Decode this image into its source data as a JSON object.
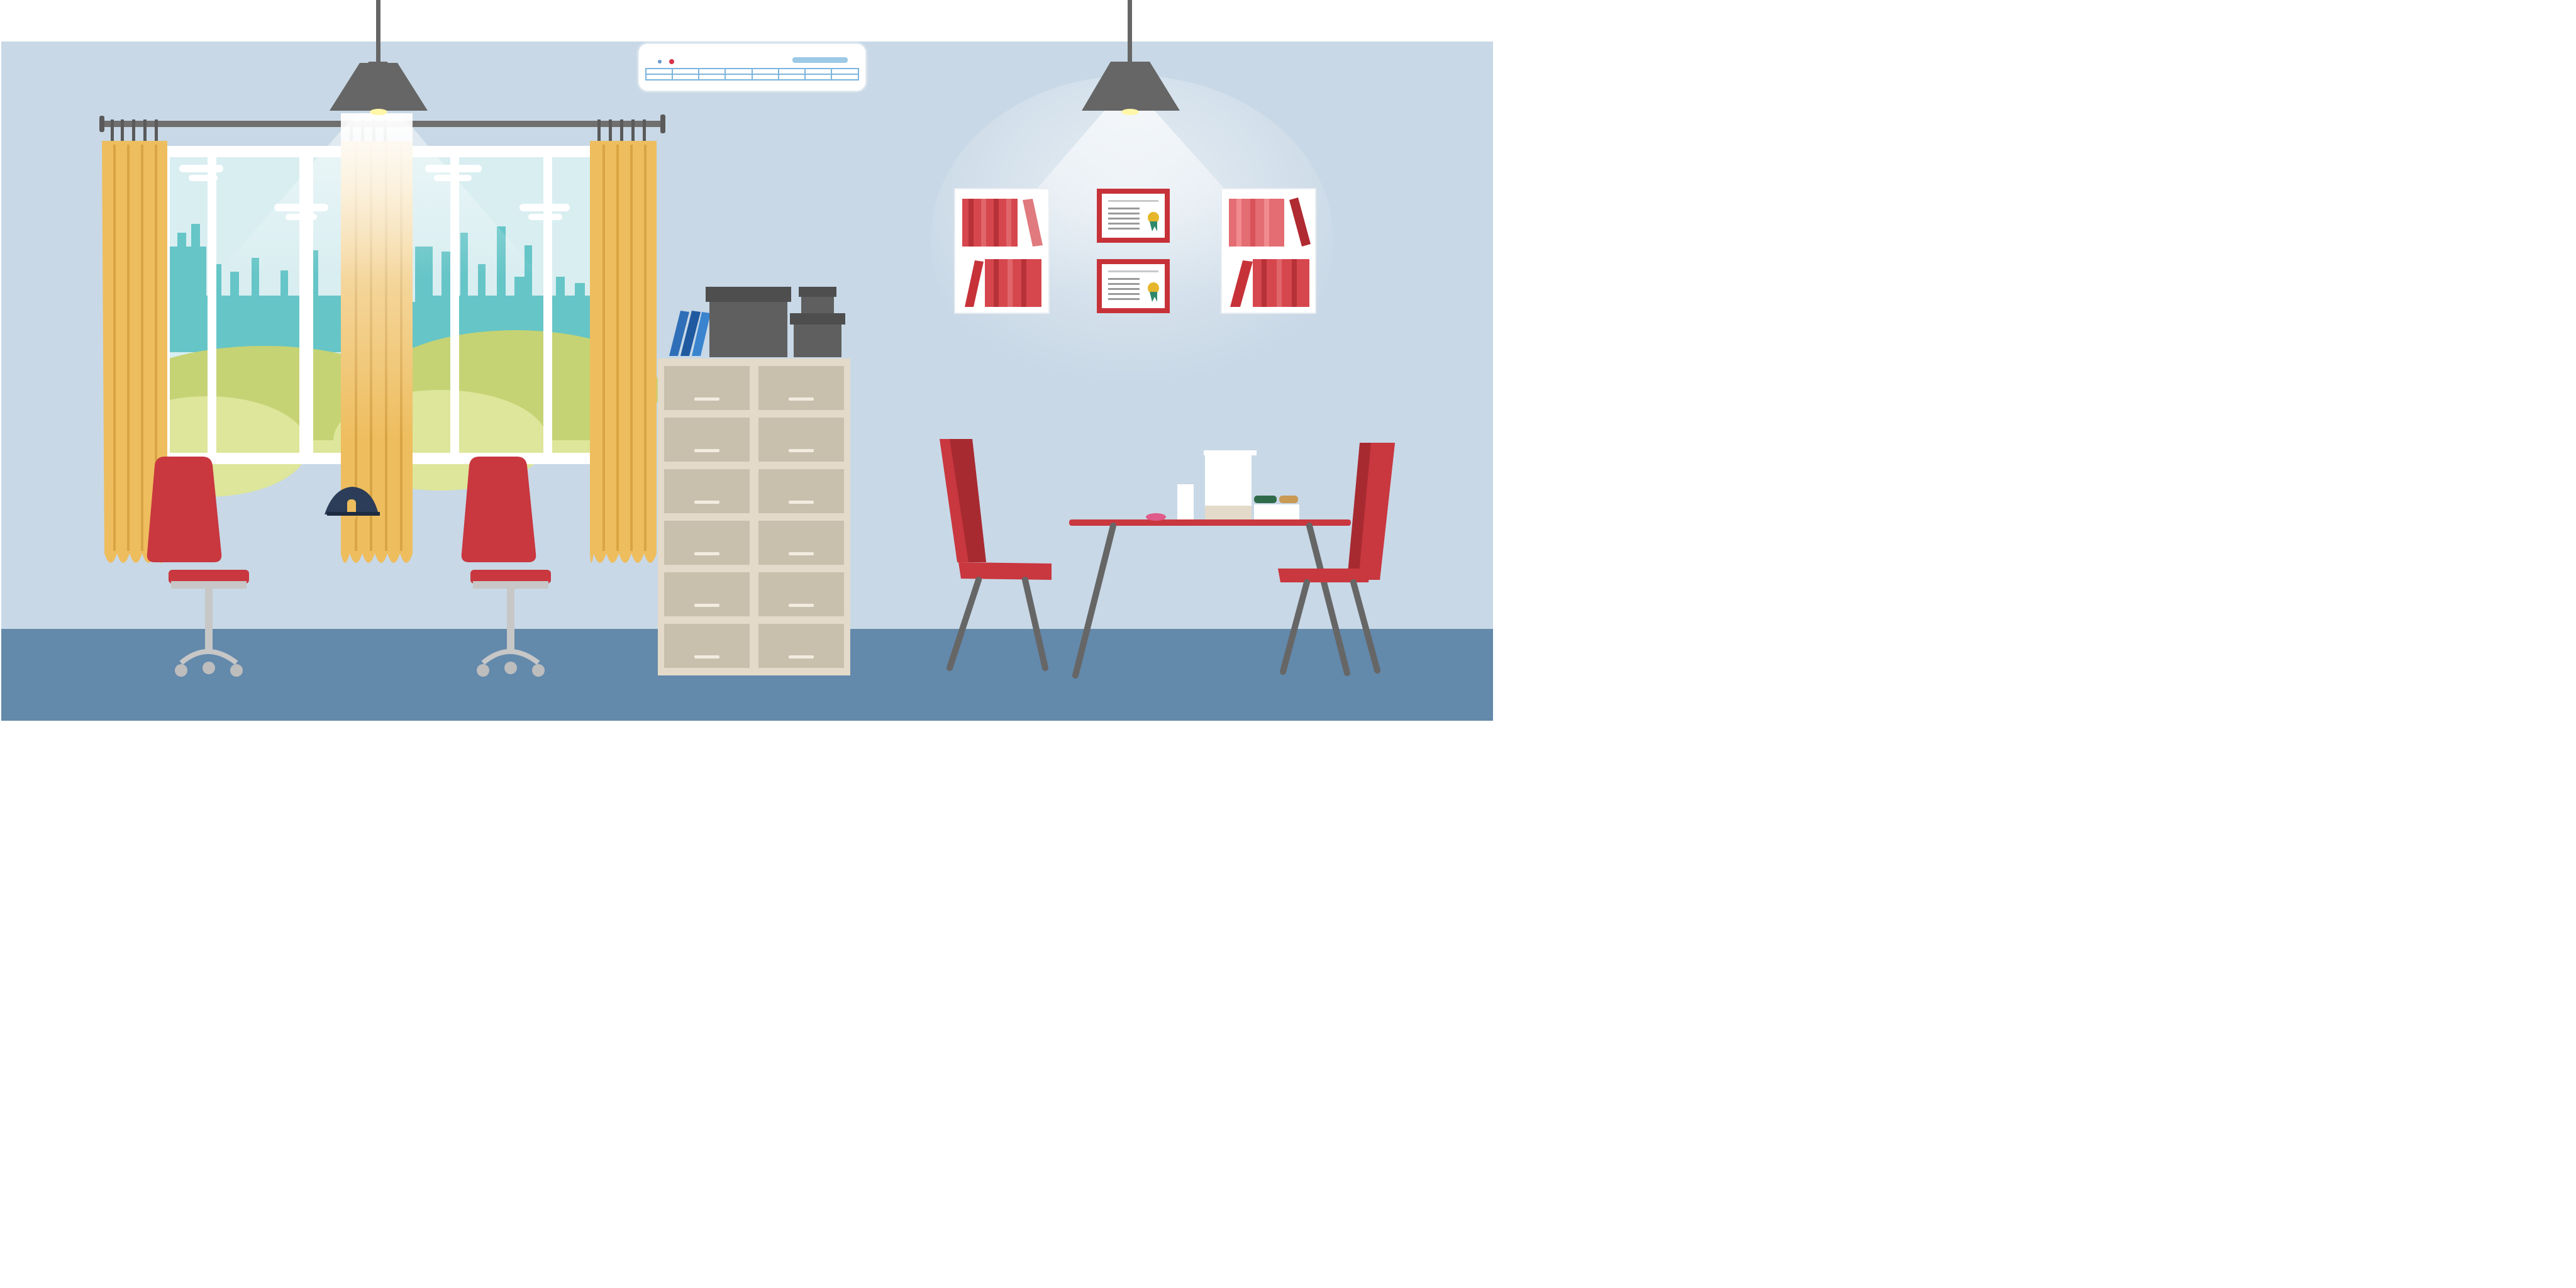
{
  "scene": {
    "colors": {
      "background": "#ffffff",
      "wall": "#c8d8e6",
      "floor": "#6389ab",
      "curtain": "#eebd5e",
      "curtain_dark": "#d9a443",
      "chair_red": "#c9373f",
      "chair_red_dark": "#a82a31",
      "cabinet": "#e3dac9",
      "drawer": "#c9bfad",
      "lamp": "#666666",
      "sky": "#d9eef1",
      "city": "#66c5c7",
      "hill": "#c5d374",
      "hill_light": "#dde69a",
      "book_blue": "#2f6fb8",
      "box_dark": "#5f5f5f"
    },
    "icons": {
      "ac_unit": "air-conditioner-icon",
      "ceiling_lamp": "ceiling-lamp-icon",
      "certificate": "certificate-icon",
      "bookshelf": "wall-bookshelf-icon",
      "office_chair": "office-chair-icon",
      "dining_chair": "dining-chair-icon",
      "cap": "cap-icon"
    }
  }
}
